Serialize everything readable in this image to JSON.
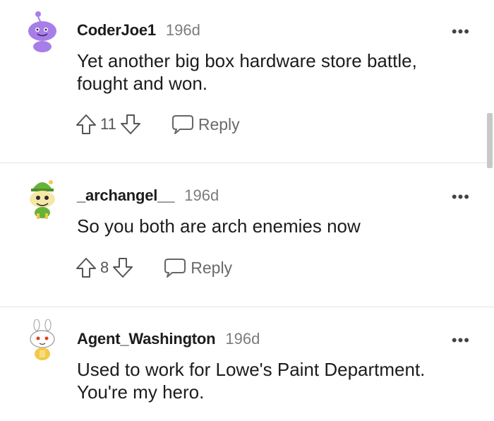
{
  "comments": [
    {
      "username": "CoderJoe1",
      "age": "196d",
      "text": "Yet another big box hardware store battle, fought and won.",
      "score": "11",
      "reply_label": "Reply",
      "more_label": "•••"
    },
    {
      "username": "_archangel__",
      "age": "196d",
      "text": "So you both are arch enemies now",
      "score": "8",
      "reply_label": "Reply",
      "more_label": "•••"
    },
    {
      "username": "Agent_Washington",
      "age": "196d",
      "text": "Used to work for Lowe's Paint Department. You're my hero.",
      "more_label": "•••"
    }
  ],
  "colors": {
    "avatar_purple": "#a77ee8",
    "avatar_green": "#66b33a",
    "avatar_yellow": "#f2c94c",
    "text_muted": "#7c7c7c",
    "divider": "#e4e4e4"
  }
}
